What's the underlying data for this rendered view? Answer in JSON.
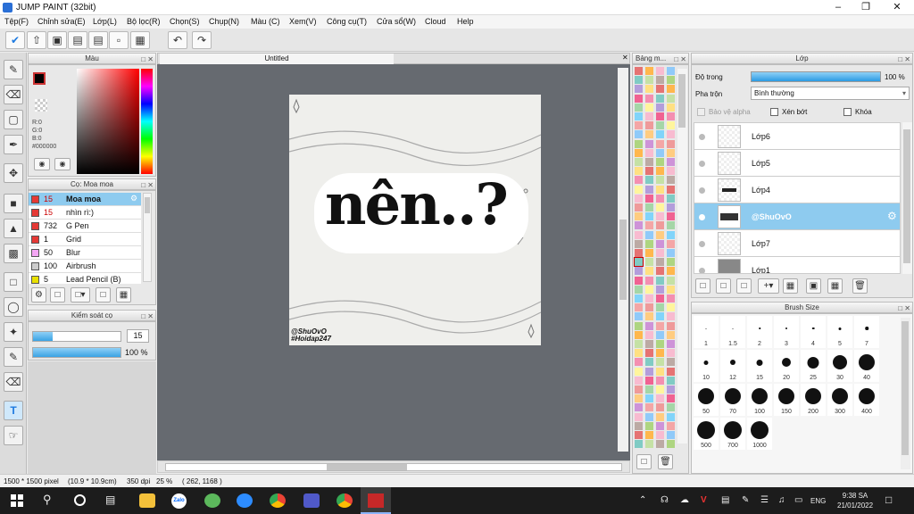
{
  "app": {
    "title": "JUMP PAINT (32bit)"
  },
  "menu": [
    "Tệp(F)",
    "Chỉnh sửa(E)",
    "Lớp(L)",
    "Bộ lọc(R)",
    "Chọn(S)",
    "Chụp(N)",
    "Màu (C)",
    "Xem(V)",
    "Công cụ(T)",
    "Cửa sổ(W)",
    "Cloud",
    "Help"
  ],
  "panels": {
    "color": "Màu",
    "brush": "Cọ: Moa moa",
    "brush_control": "Kiểm soát cọ",
    "palette": "Bảng m...",
    "layer": "Lớp",
    "brush_size": "Brush Size",
    "canvas_tab": "Untitled"
  },
  "color": {
    "r": "R:0",
    "g": "G:0",
    "b": "B:0",
    "hex": "#000000",
    "fg": "#000000",
    "bg": "#ffffff"
  },
  "brushes": [
    {
      "size": "15",
      "name": "Moa moa",
      "color": "#e53935",
      "sel": true
    },
    {
      "size": "15",
      "name": "nhìn rì:)",
      "color": "#e53935"
    },
    {
      "size": "732",
      "name": "G Pen",
      "color": "#e53935"
    },
    {
      "size": "1",
      "name": "Grid",
      "color": "#e53935"
    },
    {
      "size": "50",
      "name": "Blur",
      "color": "#f4a6f4"
    },
    {
      "size": "100",
      "name": "Airbrush",
      "color": "#cccccc"
    },
    {
      "size": "5",
      "name": "Lead Pencil (B)",
      "color": "#e8e000"
    }
  ],
  "brush_control": {
    "size": "15",
    "opacity": "100 %",
    "size_fraction": 0.22,
    "opacity_fraction": 1.0
  },
  "layer": {
    "opacity_label": "Độ trong",
    "opacity_value": "100 %",
    "blend_label": "Pha trộn",
    "blend_value": "Bình thường",
    "protect_alpha": "Bảo vệ alpha",
    "clip": "Xén bớt",
    "lock": "Khóa",
    "items": [
      {
        "name": "Lớp6"
      },
      {
        "name": "Lớp5"
      },
      {
        "name": "Lớp4"
      },
      {
        "name": "@ShuOvO",
        "sel": true
      },
      {
        "name": "Lớp7"
      },
      {
        "name": "Lớp1"
      }
    ]
  },
  "brush_sizes": [
    "1",
    "1.5",
    "2",
    "3",
    "4",
    "5",
    "7",
    "10",
    "12",
    "15",
    "20",
    "25",
    "30",
    "40",
    "50",
    "70",
    "100",
    "150",
    "200",
    "300",
    "400",
    "500",
    "700",
    "1000"
  ],
  "canvas": {
    "main_text": "nên..?",
    "sig1": "@ShuOvO",
    "sig2": "#Hoidap247"
  },
  "status": {
    "size": "1500 * 1500 pixel",
    "cm": "(10.9 * 10.9cm)",
    "dpi": "350 dpi",
    "zoom": "25 %",
    "coords": "( 262, 1168 )"
  },
  "taskbar": {
    "time": "9:38 SA",
    "date": "21/01/2022",
    "lang": "ENG"
  }
}
